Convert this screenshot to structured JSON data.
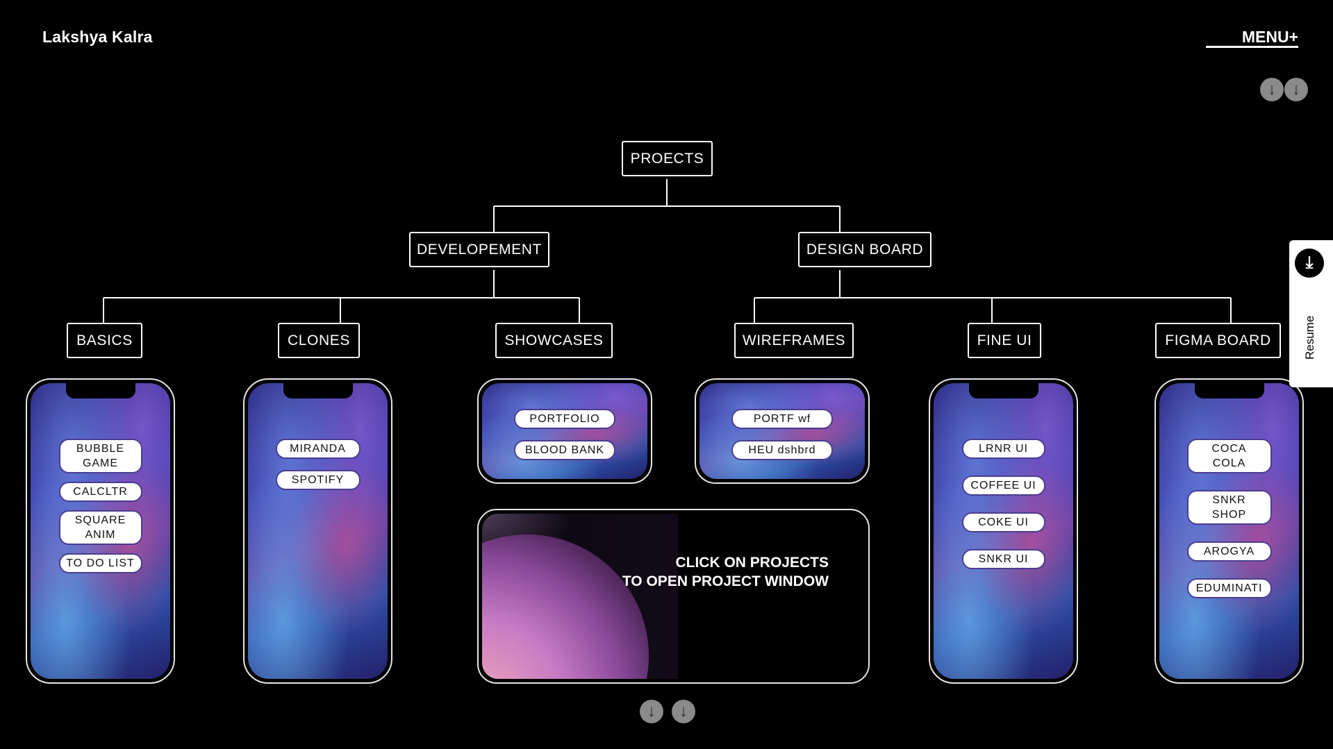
{
  "header": {
    "brand": "Lakshya Kalra",
    "menu_label": "MENU+"
  },
  "tree": {
    "root": "PROECTS",
    "branches": [
      "DEVELOPEMENT",
      "DESIGN BOARD"
    ],
    "leaves": [
      "BASICS",
      "CLONES",
      "SHOWCASES",
      "WIREFRAMES",
      "FINE UI",
      "FIGMA BOARD"
    ]
  },
  "cards": {
    "basics": [
      "BUBBLE GAME",
      "CALCLTR",
      "SQUARE ANIM",
      "TO DO LIST"
    ],
    "clones": [
      "MIRANDA",
      "SPOTIFY"
    ],
    "showcases": [
      "PORTFOLIO",
      "BLOOD BANK"
    ],
    "wireframes": [
      "PORTF wf",
      "HEU dshbrd"
    ],
    "fine_ui": [
      "LRNR UI",
      "COFFEE UI",
      "COKE UI",
      "SNKR UI"
    ],
    "figma_board": [
      "COCA COLA",
      "SNKR SHOP",
      "AROGYA",
      "EDUMINATI"
    ]
  },
  "window": {
    "message_line1": "CLICK ON PROJECTS",
    "message_line2": "TO OPEN PROJECT WINDOW"
  },
  "resume": {
    "label": "Resume",
    "icon": "download-icon"
  },
  "icons": {
    "arrow": "↓"
  },
  "colors": {
    "background": "#000000",
    "foreground": "#ffffff",
    "pill_border": "#4a3d8f",
    "arrow_button": "#8a8a8a"
  }
}
